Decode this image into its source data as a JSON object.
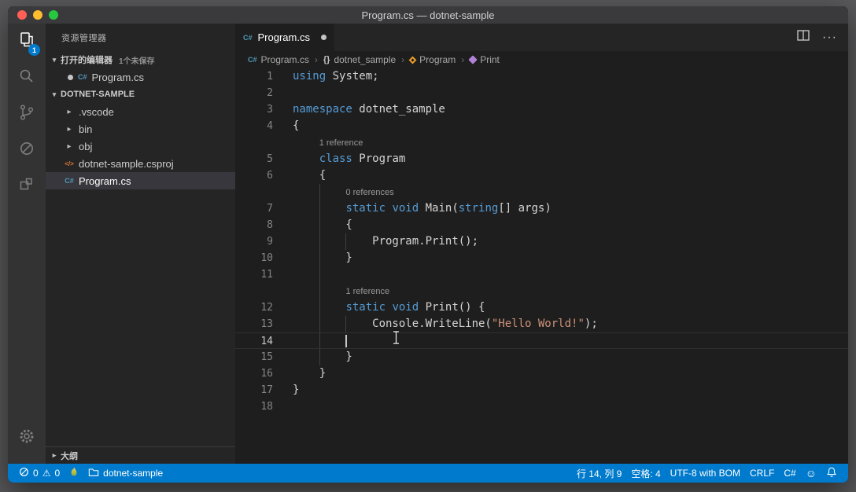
{
  "window": {
    "title": "Program.cs — dotnet-sample"
  },
  "activity_bar": {
    "explorer_badge": "1"
  },
  "sidebar": {
    "title": "资源管理器",
    "open_editors": {
      "label": "打开的编辑器",
      "badge": "1个未保存",
      "file": "Program.cs"
    },
    "project": {
      "label": "DOTNET-SAMPLE",
      "items": [
        {
          "label": ".vscode",
          "kind": "folder"
        },
        {
          "label": "bin",
          "kind": "folder"
        },
        {
          "label": "obj",
          "kind": "folder"
        },
        {
          "label": "dotnet-sample.csproj",
          "kind": "csproj"
        },
        {
          "label": "Program.cs",
          "kind": "cs",
          "selected": true
        }
      ]
    },
    "outline": {
      "label": "大纲"
    }
  },
  "editor": {
    "tab": {
      "label": "Program.cs"
    },
    "breadcrumbs": [
      {
        "label": "Program.cs",
        "icon": "csharp-file-icon"
      },
      {
        "label": "dotnet_sample",
        "icon": "namespace-icon"
      },
      {
        "label": "Program",
        "icon": "class-icon"
      },
      {
        "label": "Print",
        "icon": "method-icon"
      }
    ],
    "lines": [
      {
        "n": 1,
        "tokens": [
          [
            "kw",
            "using"
          ],
          [
            "pl",
            " System;"
          ]
        ]
      },
      {
        "n": 2,
        "tokens": []
      },
      {
        "n": 3,
        "tokens": [
          [
            "kw",
            "namespace"
          ],
          [
            "pl",
            " dotnet_sample"
          ]
        ]
      },
      {
        "n": 4,
        "tokens": [
          [
            "pl",
            "{"
          ]
        ]
      },
      {
        "lens": "1 reference",
        "indent": 4
      },
      {
        "n": 5,
        "tokens": [
          [
            "pl",
            "    "
          ],
          [
            "kw",
            "class"
          ],
          [
            "pl",
            " Program"
          ]
        ]
      },
      {
        "n": 6,
        "tokens": [
          [
            "pl",
            "    {"
          ]
        ]
      },
      {
        "lens": "0 references",
        "indent": 8,
        "guides": [
          4
        ]
      },
      {
        "n": 7,
        "guides": [
          4
        ],
        "tokens": [
          [
            "pl",
            "        "
          ],
          [
            "kw",
            "static"
          ],
          [
            "pl",
            " "
          ],
          [
            "kw",
            "void"
          ],
          [
            "pl",
            " Main("
          ],
          [
            "kw",
            "string"
          ],
          [
            "pl",
            "[] args)"
          ]
        ]
      },
      {
        "n": 8,
        "guides": [
          4
        ],
        "tokens": [
          [
            "pl",
            "        {"
          ]
        ]
      },
      {
        "n": 9,
        "guides": [
          4,
          8
        ],
        "tokens": [
          [
            "pl",
            "            Program.Print();"
          ]
        ]
      },
      {
        "n": 10,
        "guides": [
          4
        ],
        "tokens": [
          [
            "pl",
            "        }"
          ]
        ]
      },
      {
        "n": 11,
        "guides": [
          4
        ],
        "tokens": []
      },
      {
        "lens": "1 reference",
        "indent": 8,
        "guides": [
          4
        ]
      },
      {
        "n": 12,
        "guides": [
          4
        ],
        "tokens": [
          [
            "pl",
            "        "
          ],
          [
            "kw",
            "static"
          ],
          [
            "pl",
            " "
          ],
          [
            "kw",
            "void"
          ],
          [
            "pl",
            " Print() {"
          ]
        ]
      },
      {
        "n": 13,
        "guides": [
          4,
          8
        ],
        "tokens": [
          [
            "pl",
            "            Console.WriteLine("
          ],
          [
            "str",
            "\"Hello World!\""
          ],
          [
            "pl",
            ");"
          ]
        ]
      },
      {
        "n": 14,
        "guides": [
          4
        ],
        "current": true,
        "cursor": 8,
        "tokens": [
          [
            "pl",
            "        "
          ]
        ]
      },
      {
        "n": 15,
        "guides": [
          4
        ],
        "tokens": [
          [
            "pl",
            "        }"
          ]
        ]
      },
      {
        "n": 16,
        "tokens": [
          [
            "pl",
            "    }"
          ]
        ]
      },
      {
        "n": 17,
        "tokens": [
          [
            "pl",
            "}"
          ]
        ]
      },
      {
        "n": 18,
        "tokens": []
      }
    ]
  },
  "status_bar": {
    "errors": "0",
    "warnings": "0",
    "project": "dotnet-sample",
    "cursor_position": "行 14, 列 9",
    "indentation": "空格: 4",
    "encoding": "UTF-8 with BOM",
    "eol": "CRLF",
    "language": "C#"
  }
}
